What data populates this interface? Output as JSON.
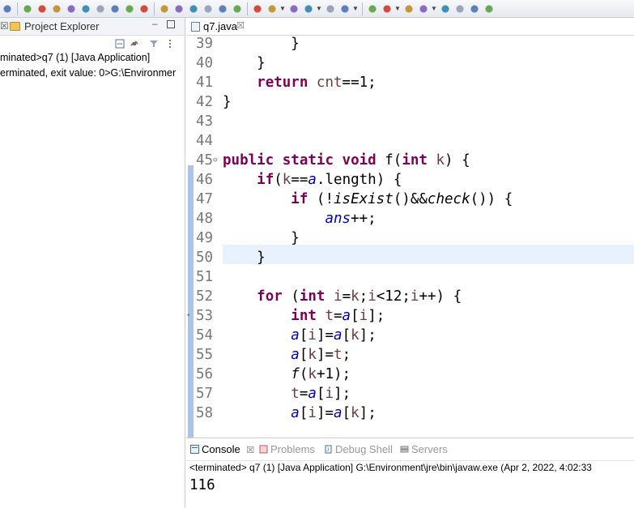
{
  "toolbar": {
    "icons": [
      "link-icon",
      "skip-breakpoints-icon",
      "resume-icon",
      "suspend-icon",
      "terminate-icon",
      "disconnect-icon",
      "step-into-icon",
      "step-over-icon",
      "step-return-icon",
      "drop-to-frame-icon",
      "use-step-filters-icon",
      "new-java-project-icon",
      "new-package-icon",
      "new-class-icon",
      "open-type-icon",
      "toggle-breadcrumb-icon",
      "show-whitespace-icon",
      "debug-icon",
      "run-icon",
      "coverage-icon",
      "external-tools-icon",
      "open-task-icon",
      "search-icon",
      "annotation-icon",
      "next-annotation-icon",
      "prev-annotation-icon",
      "last-edit-icon",
      "back-icon",
      "forward-icon",
      "pin-editor-icon"
    ]
  },
  "explorer": {
    "tab_close": "☒",
    "title": "Project Explorer",
    "minimize": "▭",
    "processes": [
      "minated>q7 (1) [Java Application]",
      "erminated, exit value: 0>G:\\Environmer"
    ]
  },
  "editor": {
    "tab_label": "q7.java",
    "tab_close": "☒",
    "lines": [
      {
        "n": "39",
        "code": "        }"
      },
      {
        "n": "40",
        "code": "    }"
      },
      {
        "n": "41",
        "code": "    return cnt==1;"
      },
      {
        "n": "42",
        "code": "}"
      },
      {
        "n": "43",
        "code": ""
      },
      {
        "n": "44",
        "code": ""
      },
      {
        "n": "45",
        "code": "public static void f(int k) {"
      },
      {
        "n": "46",
        "code": "    if(k==a.length) {"
      },
      {
        "n": "47",
        "code": "        if (!isExist()&&check()) {"
      },
      {
        "n": "48",
        "code": "            ans++;"
      },
      {
        "n": "49",
        "code": "        }"
      },
      {
        "n": "50",
        "code": "    }"
      },
      {
        "n": "51",
        "code": ""
      },
      {
        "n": "52",
        "code": "    for (int i=k;i<12;i++) {"
      },
      {
        "n": "53",
        "code": "        int t=a[i];"
      },
      {
        "n": "54",
        "code": "        a[i]=a[k];"
      },
      {
        "n": "55",
        "code": "        a[k]=t;"
      },
      {
        "n": "56",
        "code": "        f(k+1);"
      },
      {
        "n": "57",
        "code": "        t=a[i];"
      },
      {
        "n": "58",
        "code": "        a[i]=a[k];"
      }
    ]
  },
  "console": {
    "tabs": [
      {
        "label": "Console",
        "close": "☒",
        "active": true,
        "icon": "console-icon"
      },
      {
        "label": "Problems",
        "active": false,
        "icon": "problems-icon"
      },
      {
        "label": "Debug Shell",
        "active": false,
        "icon": "debug-shell-icon"
      },
      {
        "label": "Servers",
        "active": false,
        "icon": "servers-icon"
      }
    ],
    "description": "<terminated> q7 (1) [Java Application] G:\\Environment\\jre\\bin\\javaw.exe (Apr 2, 2022, 4:02:33",
    "output": "116"
  }
}
